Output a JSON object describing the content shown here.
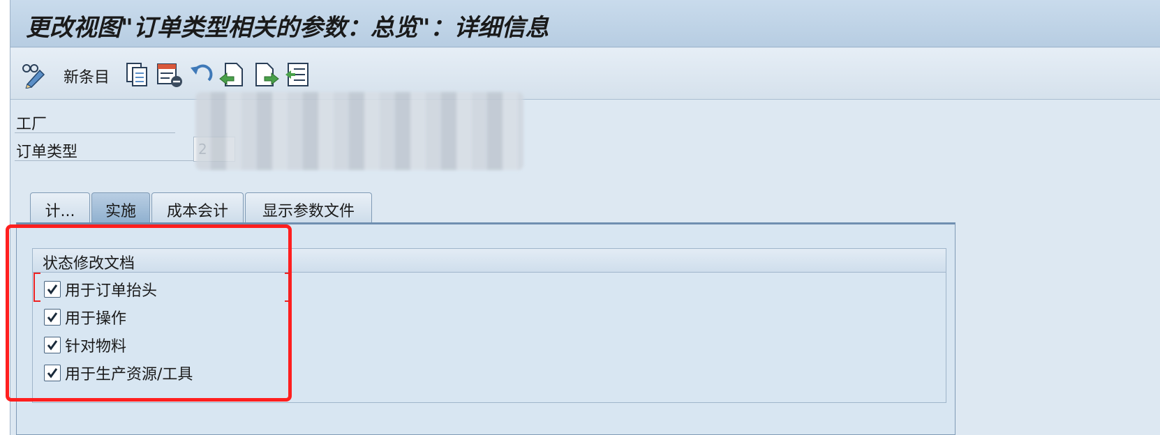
{
  "window": {
    "title": "更改视图\"订单类型相关的参数：总览\"：详细信息"
  },
  "toolbar": {
    "new_entry_label": "新条目",
    "icons": [
      "display-change-icon",
      "copy-icon",
      "delete-icon",
      "undo-icon",
      "previous-entry-icon",
      "next-entry-icon",
      "select-block-icon"
    ]
  },
  "header": {
    "plant_label": "工厂",
    "order_type_label": "订单类型",
    "order_type_value": "2"
  },
  "tabs": [
    {
      "label": "计...",
      "active": false
    },
    {
      "label": "实施",
      "active": true
    },
    {
      "label": "成本会计",
      "active": false
    },
    {
      "label": "显示参数文件",
      "active": false
    }
  ],
  "group": {
    "title": "状态修改文档",
    "checkboxes": [
      {
        "label": "用于订单抬头",
        "checked": true
      },
      {
        "label": "用于操作",
        "checked": true
      },
      {
        "label": "针对物料",
        "checked": true
      },
      {
        "label": "用于生产资源/工具",
        "checked": true
      }
    ]
  },
  "colors": {
    "highlight": "#ff1f1f",
    "title_bar": "#c9dbec",
    "panel": "#d8e6f2"
  }
}
